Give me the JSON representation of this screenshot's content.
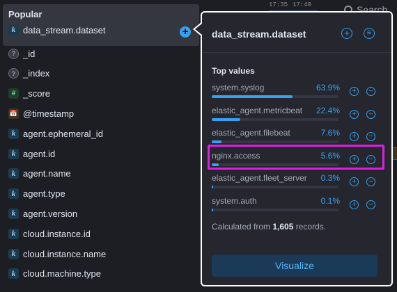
{
  "sidebar": {
    "popular": {
      "title": "Popular",
      "field": {
        "type": "k",
        "name": "data_stream.dataset"
      }
    },
    "fields": [
      {
        "type": "?",
        "name": "_id"
      },
      {
        "type": "?",
        "name": "_index"
      },
      {
        "type": "#",
        "name": "_score"
      },
      {
        "type": "📅",
        "name": "@timestamp"
      },
      {
        "type": "k",
        "name": "agent.ephemeral_id"
      },
      {
        "type": "k",
        "name": "agent.id"
      },
      {
        "type": "k",
        "name": "agent.name"
      },
      {
        "type": "k",
        "name": "agent.type"
      },
      {
        "type": "k",
        "name": "agent.version"
      },
      {
        "type": "k",
        "name": "cloud.instance.id"
      },
      {
        "type": "k",
        "name": "cloud.instance.name"
      },
      {
        "type": "k",
        "name": "cloud.machine.type"
      }
    ]
  },
  "background": {
    "tick1": "17:35",
    "tick2": "17:40",
    "search_text": "Search"
  },
  "popover": {
    "title": "data_stream.dataset",
    "top_values_title": "Top values",
    "values": [
      {
        "name": "system.syslog",
        "percent": "63.9%",
        "fraction": 0.639
      },
      {
        "name": "elastic_agent.metricbeat",
        "percent": "22.4%",
        "fraction": 0.224
      },
      {
        "name": "elastic_agent.filebeat",
        "percent": "7.6%",
        "fraction": 0.076
      },
      {
        "name": "nginx.access",
        "percent": "5.6%",
        "fraction": 0.056
      },
      {
        "name": "elastic_agent.fleet_server",
        "percent": "0.3%",
        "fraction": 0.003
      },
      {
        "name": "system.auth",
        "percent": "0.1%",
        "fraction": 0.001
      }
    ],
    "calc_prefix": "Calculated from ",
    "calc_count": "1,605",
    "calc_suffix": " records.",
    "visualize_label": "Visualize"
  },
  "colors": {
    "accent": "#36a2ef",
    "highlight": "#e11de5"
  }
}
